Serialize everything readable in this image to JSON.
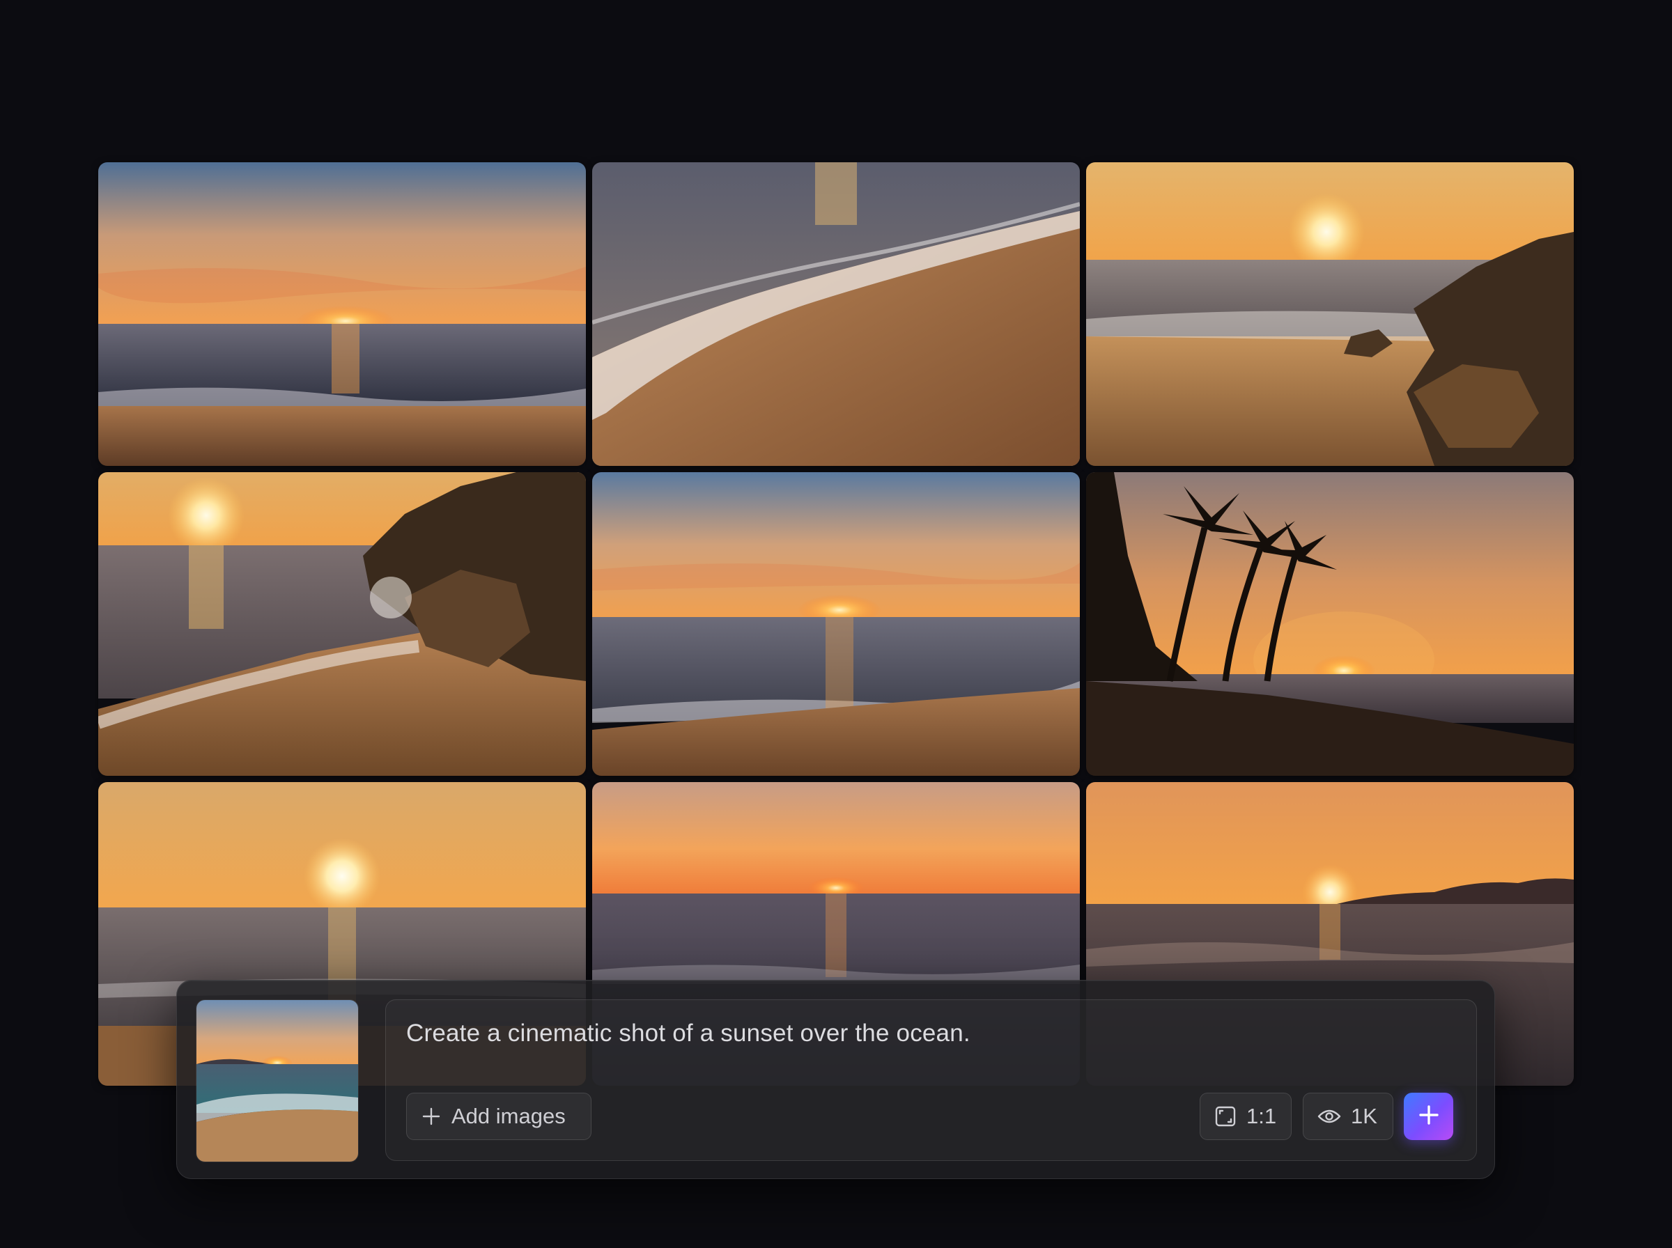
{
  "gallery": {
    "images": [
      {
        "scene": "sunset-horizon-beach"
      },
      {
        "scene": "waves-on-sand"
      },
      {
        "scene": "sun-over-rocks-right"
      },
      {
        "scene": "rocks-splash-left-sun"
      },
      {
        "scene": "sunset-horizon-waves"
      },
      {
        "scene": "palm-trees-sunset"
      },
      {
        "scene": "bright-sun-low-sea"
      },
      {
        "scene": "orange-sky-horizon"
      },
      {
        "scene": "sun-near-island"
      }
    ]
  },
  "composer": {
    "reference_image": {
      "scene": "sunset-beach-thumbnail"
    },
    "prompt": "Create a cinematic shot of a sunset over the ocean.",
    "add_images_label": "Add images",
    "aspect_ratio": "1:1",
    "quality": "1K",
    "icons": {
      "add": "plus-icon",
      "ratio": "aspect-ratio-icon",
      "quality": "eye-icon",
      "generate": "plus-icon"
    },
    "accent_gradient": [
      "#3f7bff",
      "#7c4dff",
      "#b84cf5"
    ]
  }
}
